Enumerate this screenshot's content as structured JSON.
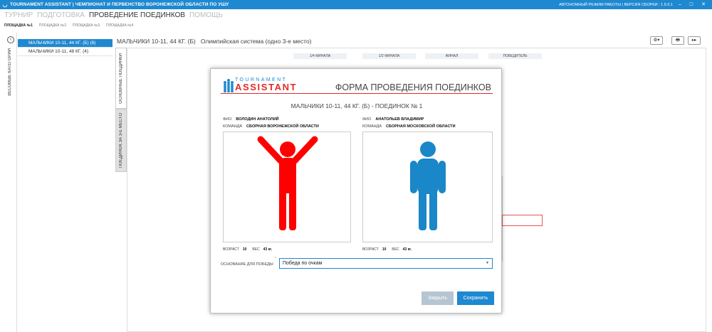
{
  "titlebar": {
    "title": "TOURNAMENT ASSISTANT | ЧЕМПИОНАТ И ПЕРВЕНСТВО ВОРОНЕЖСКОЙ ОБЛАСТИ ПО УШУ",
    "mode": "АВТОНОМНЫЙ РЕЖИМ РАБОТЫ | ВЕРСИЯ СБОРКИ : 1.5.0.1",
    "minimize": "–",
    "maximize": "▢",
    "close": "✕"
  },
  "menu": [
    "ТУРНИР",
    "ПОДГОТОВКА",
    "ПРОВЕДЕНИЕ ПОЕДИНКОВ",
    "ПОМОЩЬ"
  ],
  "platforms": [
    "ПЛОЩАДКА №1",
    "ПЛОЩАДКА №2",
    "ПЛОЩАДКА №3",
    "ПЛОЩАДКА №4"
  ],
  "sidebar": {
    "collapse_icon": "‹",
    "label": "ВЕСОВЫЕ КАТЕГОРИИ",
    "items": [
      "МАЛЬЧИКИ 10-11, 44 КГ. (Б) (8)",
      "МАЛЬЧИКИ 10-11, 48 КГ. (4)"
    ]
  },
  "tabs": {
    "main": "ОСНОВНЫЕ ПОЕДИНКИ",
    "third": "ПОЕДИНОК ЗА 3-Е МЕСТО"
  },
  "header": {
    "category": "МАЛЬЧИКИ 10-11, 44 КГ. (Б)",
    "system": "Олимпийская система (одно 3-е место)"
  },
  "toolbar": {
    "settings": "⚙▾",
    "print": "🖶",
    "next": "▸▸"
  },
  "stages": [
    "1/4 ФИНАЛА",
    "1/2 ФИНАЛА",
    "ФИНАЛ",
    "ПОБЕДИТЕЛЬ"
  ],
  "modal": {
    "brand_top": "TOURNAMENT",
    "brand_main": "ASSISTANT",
    "title": "ФОРМА ПРОВЕДЕНИЯ ПОЕДИНКОВ",
    "fight_title": "МАЛЬЧИКИ 10-11, 44 КГ. (Б)  - ПОЕДИНОК №  1",
    "labels": {
      "fio": "ФИО",
      "team": "КОМАНДА",
      "age": "ВОЗРАСТ",
      "weight": "ВЕС"
    },
    "red": {
      "name": "ВОЛОДИН АНАТОЛИЙ",
      "team": "СБОРНАЯ ВОРОНЕЖСКОЙ ОБЛАСТИ",
      "age": "10",
      "weight": "43 кг.",
      "color": "#ff0000"
    },
    "blue": {
      "name": "АНАТОЛЬЕВ ВЛАДИМИР",
      "team": "СБОРНАЯ МОСКОВСКОЙ ОБЛАСТИ",
      "age": "10",
      "weight": "43 кг.",
      "color": "#1a87c8"
    },
    "reason_label": "ОСНОВАНИЕ ДЛЯ ПОБЕДЫ",
    "reason_required": "*",
    "reason_value": "Победа по очкам",
    "close_button": "Закрыть",
    "save_button": "Сохранить"
  }
}
